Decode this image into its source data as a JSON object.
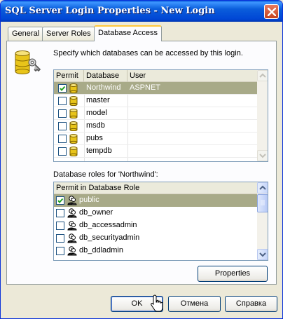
{
  "window": {
    "title": "SQL Server Login Properties - New Login"
  },
  "tabs": [
    {
      "label": "General",
      "active": false
    },
    {
      "label": "Server Roles",
      "active": false
    },
    {
      "label": "Database Access",
      "active": true
    }
  ],
  "description": "Specify which databases can be accessed by this login.",
  "databases": {
    "columns": [
      "Permit",
      "Database",
      "User"
    ],
    "rows": [
      {
        "permit": true,
        "database": "Northwind",
        "user": "ASPNET",
        "selected": true
      },
      {
        "permit": false,
        "database": "master",
        "user": "",
        "selected": false
      },
      {
        "permit": false,
        "database": "model",
        "user": "",
        "selected": false
      },
      {
        "permit": false,
        "database": "msdb",
        "user": "",
        "selected": false
      },
      {
        "permit": false,
        "database": "pubs",
        "user": "",
        "selected": false
      },
      {
        "permit": false,
        "database": "tempdb",
        "user": "",
        "selected": false
      }
    ]
  },
  "roles": {
    "label": "Database roles for 'Northwind':",
    "column": "Permit in Database Role",
    "rows": [
      {
        "permit": true,
        "name": "public",
        "selected": true
      },
      {
        "permit": false,
        "name": "db_owner",
        "selected": false
      },
      {
        "permit": false,
        "name": "db_accessadmin",
        "selected": false
      },
      {
        "permit": false,
        "name": "db_securityadmin",
        "selected": false
      },
      {
        "permit": false,
        "name": "db_ddladmin",
        "selected": false
      }
    ]
  },
  "buttons": {
    "properties": "Properties",
    "ok": "OK",
    "cancel": "Отмена",
    "help": "Справка"
  },
  "icons": {
    "close": "close-icon",
    "database": "database-icon",
    "role": "role-icon",
    "check": "check-icon",
    "illustration": "database-key-icon",
    "cursor": "mouse-cursor-icon"
  },
  "colors": {
    "title_bar": "#0a5ddb",
    "selection": "#a8aa88",
    "window_bg": "#ece9d8",
    "active_tab_accent": "#ffc83c"
  }
}
